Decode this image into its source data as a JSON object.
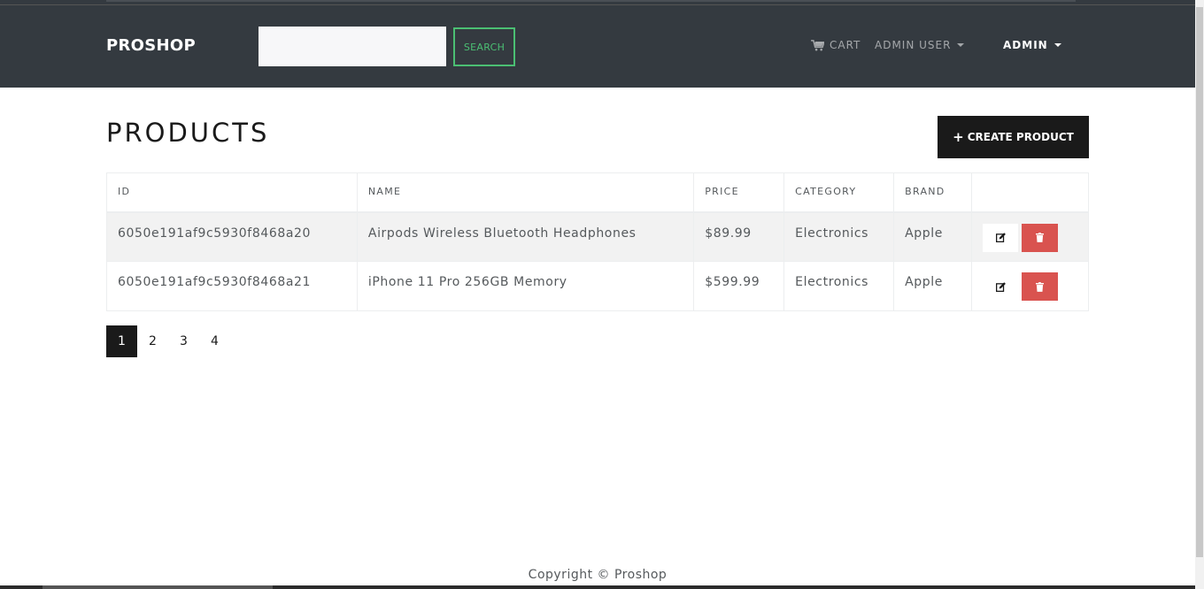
{
  "navbar": {
    "brand": "PROSHOP",
    "search_placeholder": "",
    "search_button": "SEARCH",
    "cart_label": "CART",
    "user_menu_label": "ADMIN USER",
    "admin_menu_label": "ADMIN"
  },
  "main": {
    "title": "PRODUCTS",
    "create_button": "CREATE PRODUCT",
    "table": {
      "headers": [
        "ID",
        "NAME",
        "PRICE",
        "CATEGORY",
        "BRAND",
        ""
      ],
      "rows": [
        {
          "id": "6050e191af9c5930f8468a20",
          "name": "Airpods Wireless Bluetooth Headphones",
          "price": "$89.99",
          "category": "Electronics",
          "brand": "Apple"
        },
        {
          "id": "6050e191af9c5930f8468a21",
          "name": "iPhone 11 Pro 256GB Memory",
          "price": "$599.99",
          "category": "Electronics",
          "brand": "Apple"
        }
      ]
    },
    "pagination": {
      "pages": [
        "1",
        "2",
        "3",
        "4"
      ],
      "active": "1"
    }
  },
  "footer": {
    "copyright": "Copyright © Proshop"
  },
  "colors": {
    "navbar_bg": "#343a40",
    "search_accent": "#4bbf73",
    "primary_dark": "#1a1a1a",
    "danger": "#d9534f"
  },
  "icons": {
    "cart": "cart-icon",
    "edit": "edit-icon",
    "delete": "trash-icon",
    "create": "plus-icon"
  }
}
